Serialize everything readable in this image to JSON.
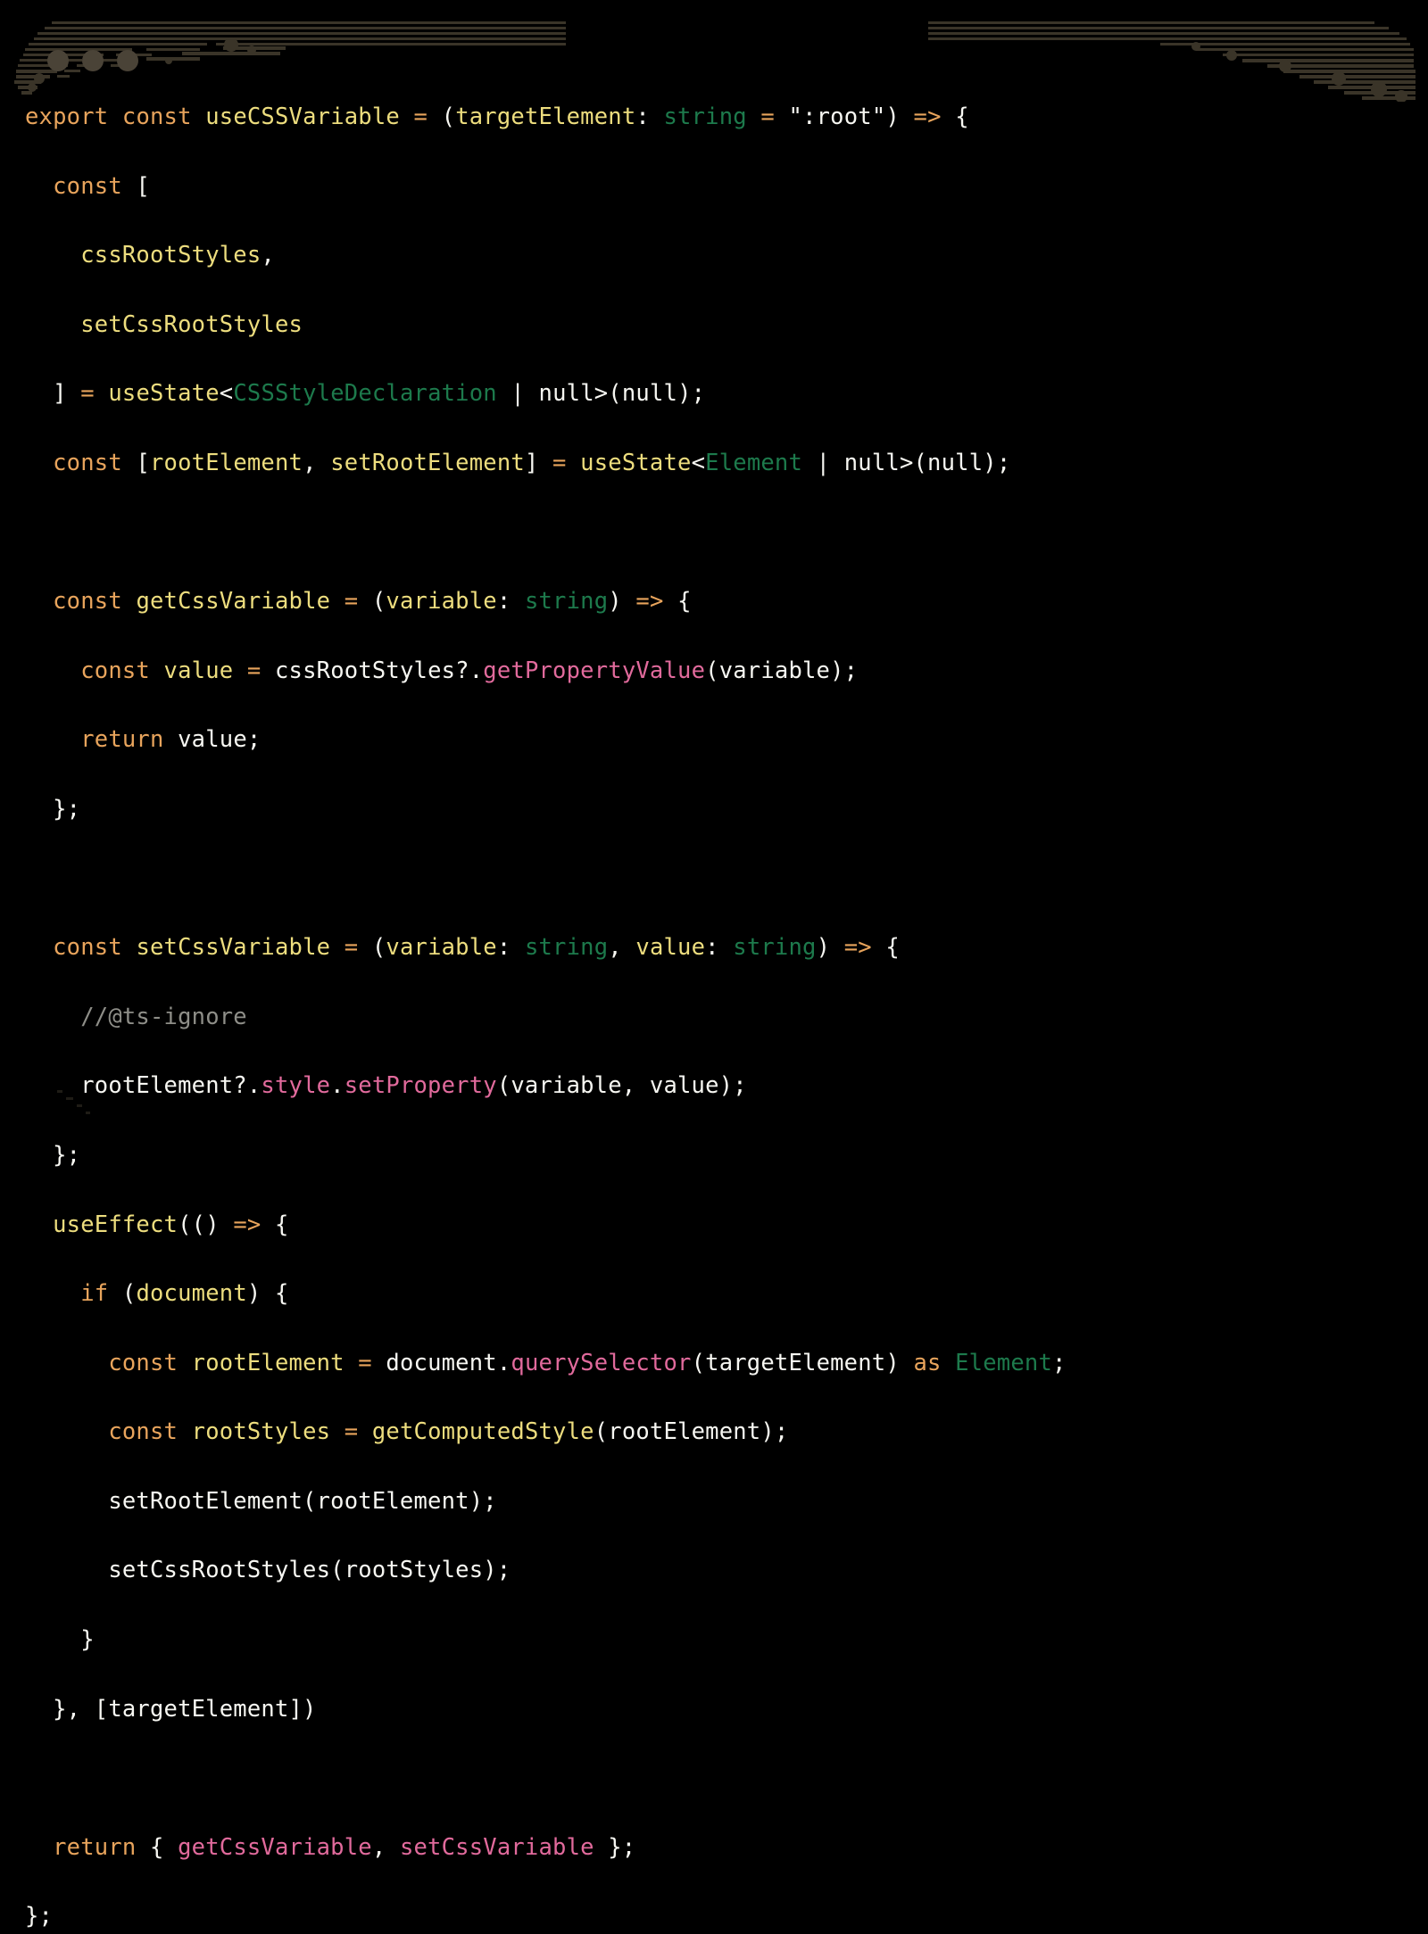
{
  "window": {
    "background_color": "#000000",
    "decoration_color": "#3a3428",
    "dot_color": "#4a4337",
    "dots": [
      "window-dot-1",
      "window-dot-2",
      "window-dot-3"
    ]
  },
  "theme": {
    "keyword": "#e8a45c",
    "function": "#eddd7e",
    "type": "#1d7a4c",
    "property": "#e16a9c",
    "comment": "#8e8e88",
    "plain": "#f7f7f2",
    "background": "#000000"
  },
  "code": {
    "language": "typescript",
    "lines": [
      [
        {
          "t": "export",
          "c": "kw"
        },
        {
          "t": " ",
          "c": "plain"
        },
        {
          "t": "const",
          "c": "kw"
        },
        {
          "t": " ",
          "c": "plain"
        },
        {
          "t": "useCSSVariable",
          "c": "fn"
        },
        {
          "t": " ",
          "c": "plain"
        },
        {
          "t": "=",
          "c": "op"
        },
        {
          "t": " ",
          "c": "plain"
        },
        {
          "t": "(",
          "c": "plain"
        },
        {
          "t": "targetElement",
          "c": "fn"
        },
        {
          "t": ": ",
          "c": "plain"
        },
        {
          "t": "string",
          "c": "type"
        },
        {
          "t": " ",
          "c": "plain"
        },
        {
          "t": "=",
          "c": "op"
        },
        {
          "t": " ",
          "c": "plain"
        },
        {
          "t": "\":root\"",
          "c": "str"
        },
        {
          "t": ")",
          "c": "plain"
        },
        {
          "t": " ",
          "c": "plain"
        },
        {
          "t": "=>",
          "c": "op"
        },
        {
          "t": " ",
          "c": "plain"
        },
        {
          "t": "{",
          "c": "plain"
        }
      ],
      [
        {
          "t": "  ",
          "c": "plain"
        },
        {
          "t": "const",
          "c": "kw"
        },
        {
          "t": " ",
          "c": "plain"
        },
        {
          "t": "[",
          "c": "plain"
        }
      ],
      [
        {
          "t": "    ",
          "c": "plain"
        },
        {
          "t": "cssRootStyles",
          "c": "fn"
        },
        {
          "t": ",",
          "c": "plain"
        }
      ],
      [
        {
          "t": "    ",
          "c": "plain"
        },
        {
          "t": "setCssRootStyles",
          "c": "fn"
        }
      ],
      [
        {
          "t": "  ",
          "c": "plain"
        },
        {
          "t": "]",
          "c": "plain"
        },
        {
          "t": " ",
          "c": "plain"
        },
        {
          "t": "=",
          "c": "op"
        },
        {
          "t": " ",
          "c": "plain"
        },
        {
          "t": "useState",
          "c": "fn"
        },
        {
          "t": "<",
          "c": "plain"
        },
        {
          "t": "CSSStyleDeclaration",
          "c": "type"
        },
        {
          "t": " ",
          "c": "plain"
        },
        {
          "t": "|",
          "c": "plain"
        },
        {
          "t": " ",
          "c": "plain"
        },
        {
          "t": "null",
          "c": "plain"
        },
        {
          "t": ">(",
          "c": "plain"
        },
        {
          "t": "null",
          "c": "plain"
        },
        {
          "t": ");",
          "c": "plain"
        }
      ],
      [
        {
          "t": "  ",
          "c": "plain"
        },
        {
          "t": "const",
          "c": "kw"
        },
        {
          "t": " ",
          "c": "plain"
        },
        {
          "t": "[",
          "c": "plain"
        },
        {
          "t": "rootElement",
          "c": "fn"
        },
        {
          "t": ", ",
          "c": "plain"
        },
        {
          "t": "setRootElement",
          "c": "fn"
        },
        {
          "t": "]",
          "c": "plain"
        },
        {
          "t": " ",
          "c": "plain"
        },
        {
          "t": "=",
          "c": "op"
        },
        {
          "t": " ",
          "c": "plain"
        },
        {
          "t": "useState",
          "c": "fn"
        },
        {
          "t": "<",
          "c": "plain"
        },
        {
          "t": "Element",
          "c": "type"
        },
        {
          "t": " ",
          "c": "plain"
        },
        {
          "t": "|",
          "c": "plain"
        },
        {
          "t": " ",
          "c": "plain"
        },
        {
          "t": "null",
          "c": "plain"
        },
        {
          "t": ">(",
          "c": "plain"
        },
        {
          "t": "null",
          "c": "plain"
        },
        {
          "t": ");",
          "c": "plain"
        }
      ],
      [],
      [
        {
          "t": "  ",
          "c": "plain"
        },
        {
          "t": "const",
          "c": "kw"
        },
        {
          "t": " ",
          "c": "plain"
        },
        {
          "t": "getCssVariable",
          "c": "fn"
        },
        {
          "t": " ",
          "c": "plain"
        },
        {
          "t": "=",
          "c": "op"
        },
        {
          "t": " ",
          "c": "plain"
        },
        {
          "t": "(",
          "c": "plain"
        },
        {
          "t": "variable",
          "c": "fn"
        },
        {
          "t": ": ",
          "c": "plain"
        },
        {
          "t": "string",
          "c": "type"
        },
        {
          "t": ")",
          "c": "plain"
        },
        {
          "t": " ",
          "c": "plain"
        },
        {
          "t": "=>",
          "c": "op"
        },
        {
          "t": " ",
          "c": "plain"
        },
        {
          "t": "{",
          "c": "plain"
        }
      ],
      [
        {
          "t": "    ",
          "c": "plain"
        },
        {
          "t": "const",
          "c": "kw"
        },
        {
          "t": " ",
          "c": "plain"
        },
        {
          "t": "value",
          "c": "fn"
        },
        {
          "t": " ",
          "c": "plain"
        },
        {
          "t": "=",
          "c": "op"
        },
        {
          "t": " ",
          "c": "plain"
        },
        {
          "t": "cssRootStyles?.",
          "c": "plain"
        },
        {
          "t": "getPropertyValue",
          "c": "prop"
        },
        {
          "t": "(variable);",
          "c": "plain"
        }
      ],
      [
        {
          "t": "    ",
          "c": "plain"
        },
        {
          "t": "return",
          "c": "kw"
        },
        {
          "t": " ",
          "c": "plain"
        },
        {
          "t": "value;",
          "c": "plain"
        }
      ],
      [
        {
          "t": "  ",
          "c": "plain"
        },
        {
          "t": "};",
          "c": "plain"
        }
      ],
      [],
      [
        {
          "t": "  ",
          "c": "plain"
        },
        {
          "t": "const",
          "c": "kw"
        },
        {
          "t": " ",
          "c": "plain"
        },
        {
          "t": "setCssVariable",
          "c": "fn"
        },
        {
          "t": " ",
          "c": "plain"
        },
        {
          "t": "=",
          "c": "op"
        },
        {
          "t": " ",
          "c": "plain"
        },
        {
          "t": "(",
          "c": "plain"
        },
        {
          "t": "variable",
          "c": "fn"
        },
        {
          "t": ": ",
          "c": "plain"
        },
        {
          "t": "string",
          "c": "type"
        },
        {
          "t": ", ",
          "c": "plain"
        },
        {
          "t": "value",
          "c": "fn"
        },
        {
          "t": ": ",
          "c": "plain"
        },
        {
          "t": "string",
          "c": "type"
        },
        {
          "t": ")",
          "c": "plain"
        },
        {
          "t": " ",
          "c": "plain"
        },
        {
          "t": "=>",
          "c": "op"
        },
        {
          "t": " ",
          "c": "plain"
        },
        {
          "t": "{",
          "c": "plain"
        }
      ],
      [
        {
          "t": "    ",
          "c": "plain"
        },
        {
          "t": "//@ts-ignore",
          "c": "cmt"
        }
      ],
      [
        {
          "t": "    ",
          "c": "plain"
        },
        {
          "t": "rootElement?.",
          "c": "plain"
        },
        {
          "t": "style",
          "c": "prop"
        },
        {
          "t": ".",
          "c": "plain"
        },
        {
          "t": "setProperty",
          "c": "prop"
        },
        {
          "t": "(variable, value);",
          "c": "plain"
        }
      ],
      [
        {
          "t": "  ",
          "c": "plain"
        },
        {
          "t": "};",
          "c": "plain"
        }
      ],
      [
        {
          "t": "  ",
          "c": "plain"
        },
        {
          "t": "useEffect",
          "c": "fn"
        },
        {
          "t": "(()",
          "c": "plain"
        },
        {
          "t": " ",
          "c": "plain"
        },
        {
          "t": "=>",
          "c": "op"
        },
        {
          "t": " ",
          "c": "plain"
        },
        {
          "t": "{",
          "c": "plain"
        }
      ],
      [
        {
          "t": "    ",
          "c": "plain"
        },
        {
          "t": "if",
          "c": "kw"
        },
        {
          "t": " ",
          "c": "plain"
        },
        {
          "t": "(",
          "c": "plain"
        },
        {
          "t": "document",
          "c": "fn"
        },
        {
          "t": ")",
          "c": "plain"
        },
        {
          "t": " ",
          "c": "plain"
        },
        {
          "t": "{",
          "c": "plain"
        }
      ],
      [
        {
          "t": "      ",
          "c": "plain"
        },
        {
          "t": "const",
          "c": "kw"
        },
        {
          "t": " ",
          "c": "plain"
        },
        {
          "t": "rootElement",
          "c": "fn"
        },
        {
          "t": " ",
          "c": "plain"
        },
        {
          "t": "=",
          "c": "op"
        },
        {
          "t": " ",
          "c": "plain"
        },
        {
          "t": "document.",
          "c": "plain"
        },
        {
          "t": "querySelector",
          "c": "prop"
        },
        {
          "t": "(targetElement)",
          "c": "plain"
        },
        {
          "t": " ",
          "c": "plain"
        },
        {
          "t": "as",
          "c": "kw"
        },
        {
          "t": " ",
          "c": "plain"
        },
        {
          "t": "Element",
          "c": "type"
        },
        {
          "t": ";",
          "c": "plain"
        }
      ],
      [
        {
          "t": "      ",
          "c": "plain"
        },
        {
          "t": "const",
          "c": "kw"
        },
        {
          "t": " ",
          "c": "plain"
        },
        {
          "t": "rootStyles",
          "c": "fn"
        },
        {
          "t": " ",
          "c": "plain"
        },
        {
          "t": "=",
          "c": "op"
        },
        {
          "t": " ",
          "c": "plain"
        },
        {
          "t": "getComputedStyle",
          "c": "fn"
        },
        {
          "t": "(rootElement);",
          "c": "plain"
        }
      ],
      [
        {
          "t": "      ",
          "c": "plain"
        },
        {
          "t": "setRootElement(rootElement);",
          "c": "plain"
        }
      ],
      [
        {
          "t": "      ",
          "c": "plain"
        },
        {
          "t": "setCssRootStyles(rootStyles);",
          "c": "plain"
        }
      ],
      [
        {
          "t": "    ",
          "c": "plain"
        },
        {
          "t": "}",
          "c": "plain"
        }
      ],
      [
        {
          "t": "  ",
          "c": "plain"
        },
        {
          "t": "}, [targetElement])",
          "c": "plain"
        }
      ],
      [],
      [
        {
          "t": "  ",
          "c": "plain"
        },
        {
          "t": "return",
          "c": "kw"
        },
        {
          "t": " ",
          "c": "plain"
        },
        {
          "t": "{ ",
          "c": "plain"
        },
        {
          "t": "getCssVariable",
          "c": "prop"
        },
        {
          "t": ", ",
          "c": "plain"
        },
        {
          "t": "setCssVariable",
          "c": "prop"
        },
        {
          "t": " };",
          "c": "plain"
        }
      ],
      [
        {
          "t": "};",
          "c": "plain"
        }
      ]
    ]
  }
}
